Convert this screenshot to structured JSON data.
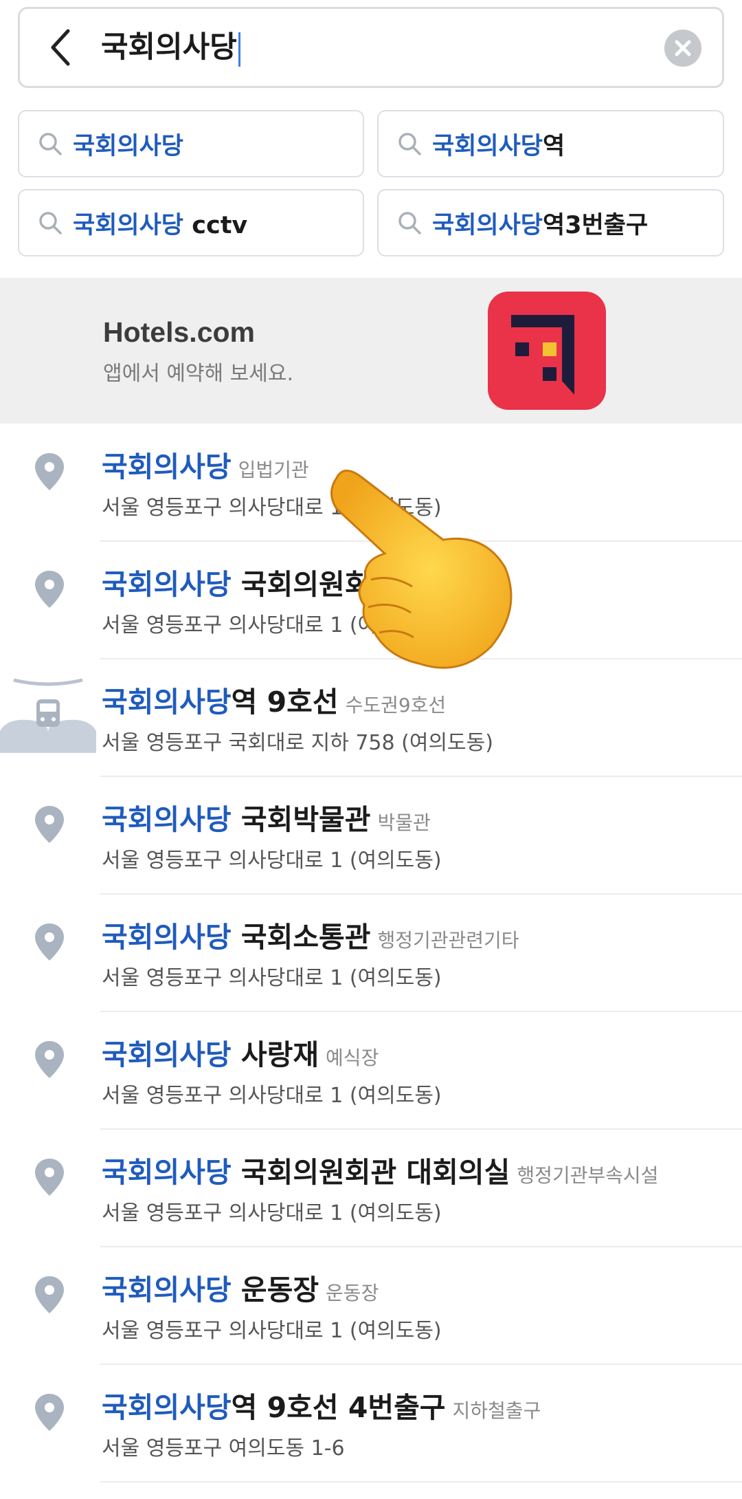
{
  "search": {
    "query": "국회의사당"
  },
  "suggestions": [
    {
      "highlight": "국회의사당",
      "rest": ""
    },
    {
      "highlight": "국회의사당",
      "rest": "역"
    },
    {
      "highlight": "국회의사당",
      "rest": " cctv"
    },
    {
      "highlight": "국회의사당",
      "rest": "역3번출구"
    }
  ],
  "ad": {
    "title": "Hotels.com",
    "subtitle": "앱에서 예약해 보세요."
  },
  "results": [
    {
      "icon": "pin-icon",
      "highlight": "국회의사당",
      "rest": "",
      "category": "입법기관",
      "address": "서울 영등포구 의사당대로 1 (여의도동)"
    },
    {
      "icon": "pin-icon",
      "highlight": "국회의사당",
      "rest": " 국회의원회관",
      "category": "",
      "address": "서울 영등포구 의사당대로 1 (여의도동)"
    },
    {
      "icon": "train-icon",
      "highlight": "국회의사당",
      "rest": "역 9호선",
      "category": "수도권9호선",
      "address": "서울 영등포구 국회대로 지하 758 (여의도동)"
    },
    {
      "icon": "pin-icon",
      "highlight": "국회의사당",
      "rest": " 국회박물관",
      "category": "박물관",
      "address": "서울 영등포구 의사당대로 1 (여의도동)"
    },
    {
      "icon": "pin-icon",
      "highlight": "국회의사당",
      "rest": " 국회소통관",
      "category": "행정기관관련기타",
      "address": "서울 영등포구 의사당대로 1 (여의도동)"
    },
    {
      "icon": "pin-icon",
      "highlight": "국회의사당",
      "rest": " 사랑재",
      "category": "예식장",
      "address": "서울 영등포구 의사당대로 1 (여의도동)"
    },
    {
      "icon": "pin-icon",
      "highlight": "국회의사당",
      "rest": " 국회의원회관 대회의실",
      "category": "행정기관부속시설",
      "address": "서울 영등포구 의사당대로 1 (여의도동)"
    },
    {
      "icon": "pin-icon",
      "highlight": "국회의사당",
      "rest": " 운동장",
      "category": "운동장",
      "address": "서울 영등포구 의사당대로 1 (여의도동)"
    },
    {
      "icon": "pin-icon",
      "highlight": "국회의사당",
      "rest": "역 9호선 4번출구",
      "category": "지하철출구",
      "address": "서울 영등포구 여의도동 1-6"
    }
  ],
  "colors": {
    "highlight": "#1f5bbd",
    "ad_logo": "#ea3249",
    "pin": "#aab4c0"
  }
}
